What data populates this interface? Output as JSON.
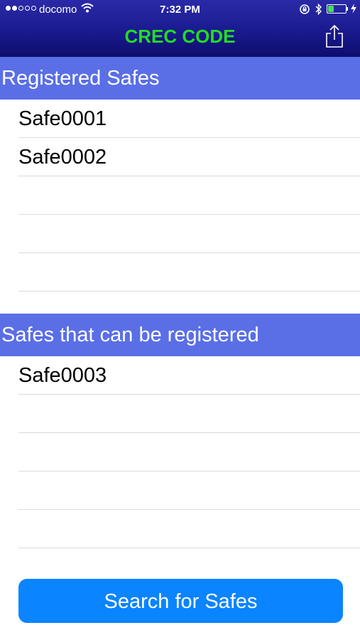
{
  "status_bar": {
    "carrier": "docomo",
    "time": "7:32 PM",
    "signal_bars": 2,
    "signal_total": 5,
    "battery_level": 0.35,
    "icons": [
      "wifi-icon",
      "orientation-lock-icon",
      "bluetooth-icon",
      "battery-icon",
      "charging-icon"
    ]
  },
  "nav": {
    "title": "CREC CODE",
    "title_color": "#22dd22",
    "share_icon": "share-icon"
  },
  "registered": {
    "header": "Registered Safes",
    "items": [
      "Safe0001",
      "Safe0002",
      "",
      "",
      ""
    ]
  },
  "available": {
    "header": "Safes that can be registered",
    "items": [
      "Safe0003",
      "",
      "",
      "",
      ""
    ]
  },
  "search_button": {
    "label": "Search for Safes",
    "color": "#0a84ff"
  },
  "colors": {
    "header_bg": "#5a6fe6",
    "nav_bg": "#1a1a8e"
  }
}
